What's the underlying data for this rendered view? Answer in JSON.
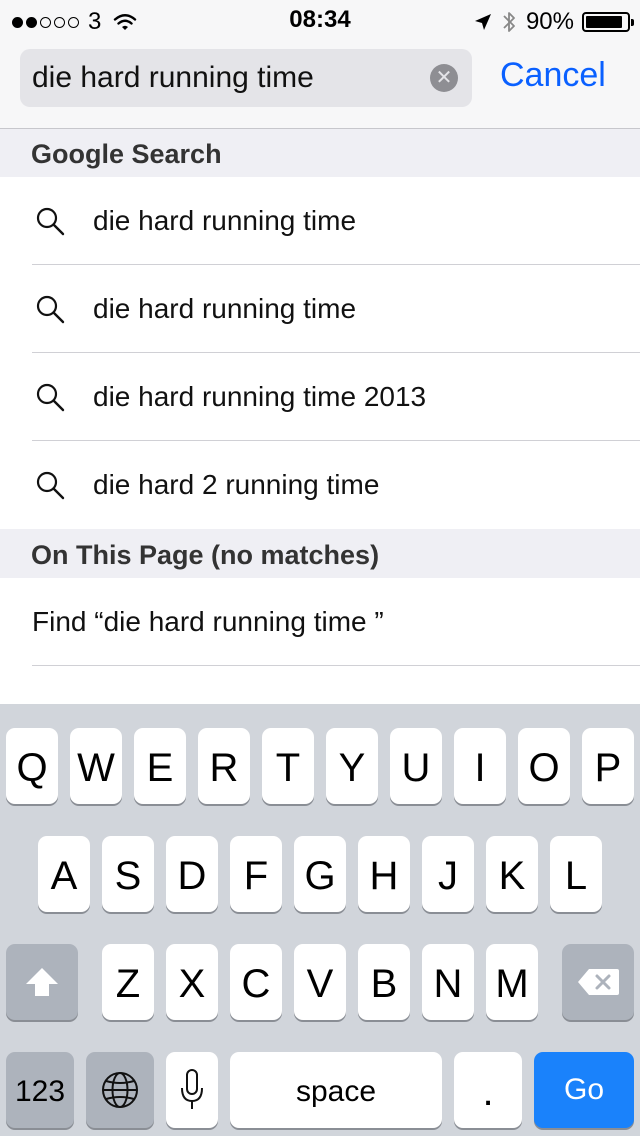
{
  "status_bar": {
    "carrier": "3",
    "time": "08:34",
    "battery_percent": "90%",
    "battery_level": 0.9,
    "signal_bars_filled": 2,
    "signal_bars_total": 5
  },
  "search": {
    "query": "die hard running time",
    "cancel_label": "Cancel"
  },
  "sections": {
    "google_search": "Google Search",
    "on_this_page": "On This Page (no matches)"
  },
  "suggestions": [
    {
      "text": "die hard running time"
    },
    {
      "text": "die hard running time"
    },
    {
      "text": "die hard running time 2013"
    },
    {
      "text": "die hard 2 running time"
    }
  ],
  "find_on_page": "Find “die hard running time ”",
  "keyboard": {
    "row1": [
      "Q",
      "W",
      "E",
      "R",
      "T",
      "Y",
      "U",
      "I",
      "O",
      "P"
    ],
    "row2": [
      "A",
      "S",
      "D",
      "F",
      "G",
      "H",
      "J",
      "K",
      "L"
    ],
    "row3": [
      "Z",
      "X",
      "C",
      "V",
      "B",
      "N",
      "M"
    ],
    "numbers_label": "123",
    "space_label": "space",
    "period_label": ".",
    "go_label": "Go"
  },
  "colors": {
    "accent": "#0a60ff",
    "go_key": "#1a82fb",
    "keyboard_bg": "#d1d5db",
    "section_bg": "#efeff4"
  }
}
